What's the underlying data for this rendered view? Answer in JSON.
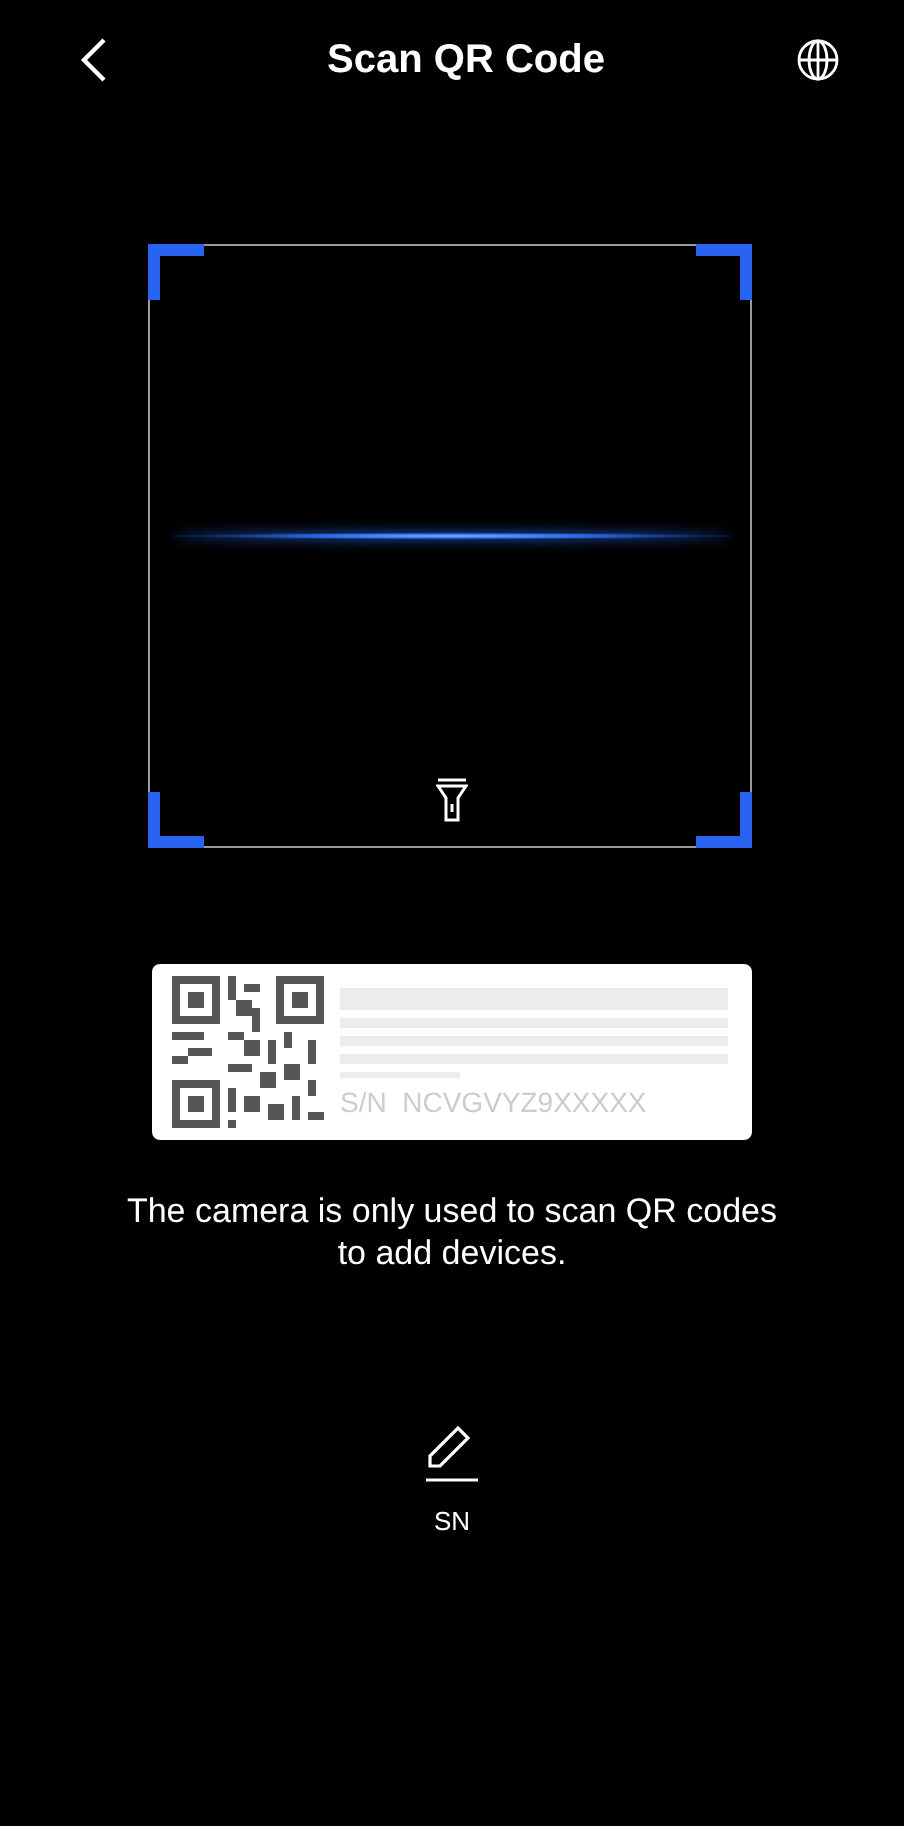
{
  "header": {
    "title": "Scan QR Code"
  },
  "label_sample": {
    "serial": "S/N  NCVGVYZ9XXXXX"
  },
  "notice": "The camera is only used to scan QR codes to add devices.",
  "manual_entry": {
    "label": "SN"
  }
}
